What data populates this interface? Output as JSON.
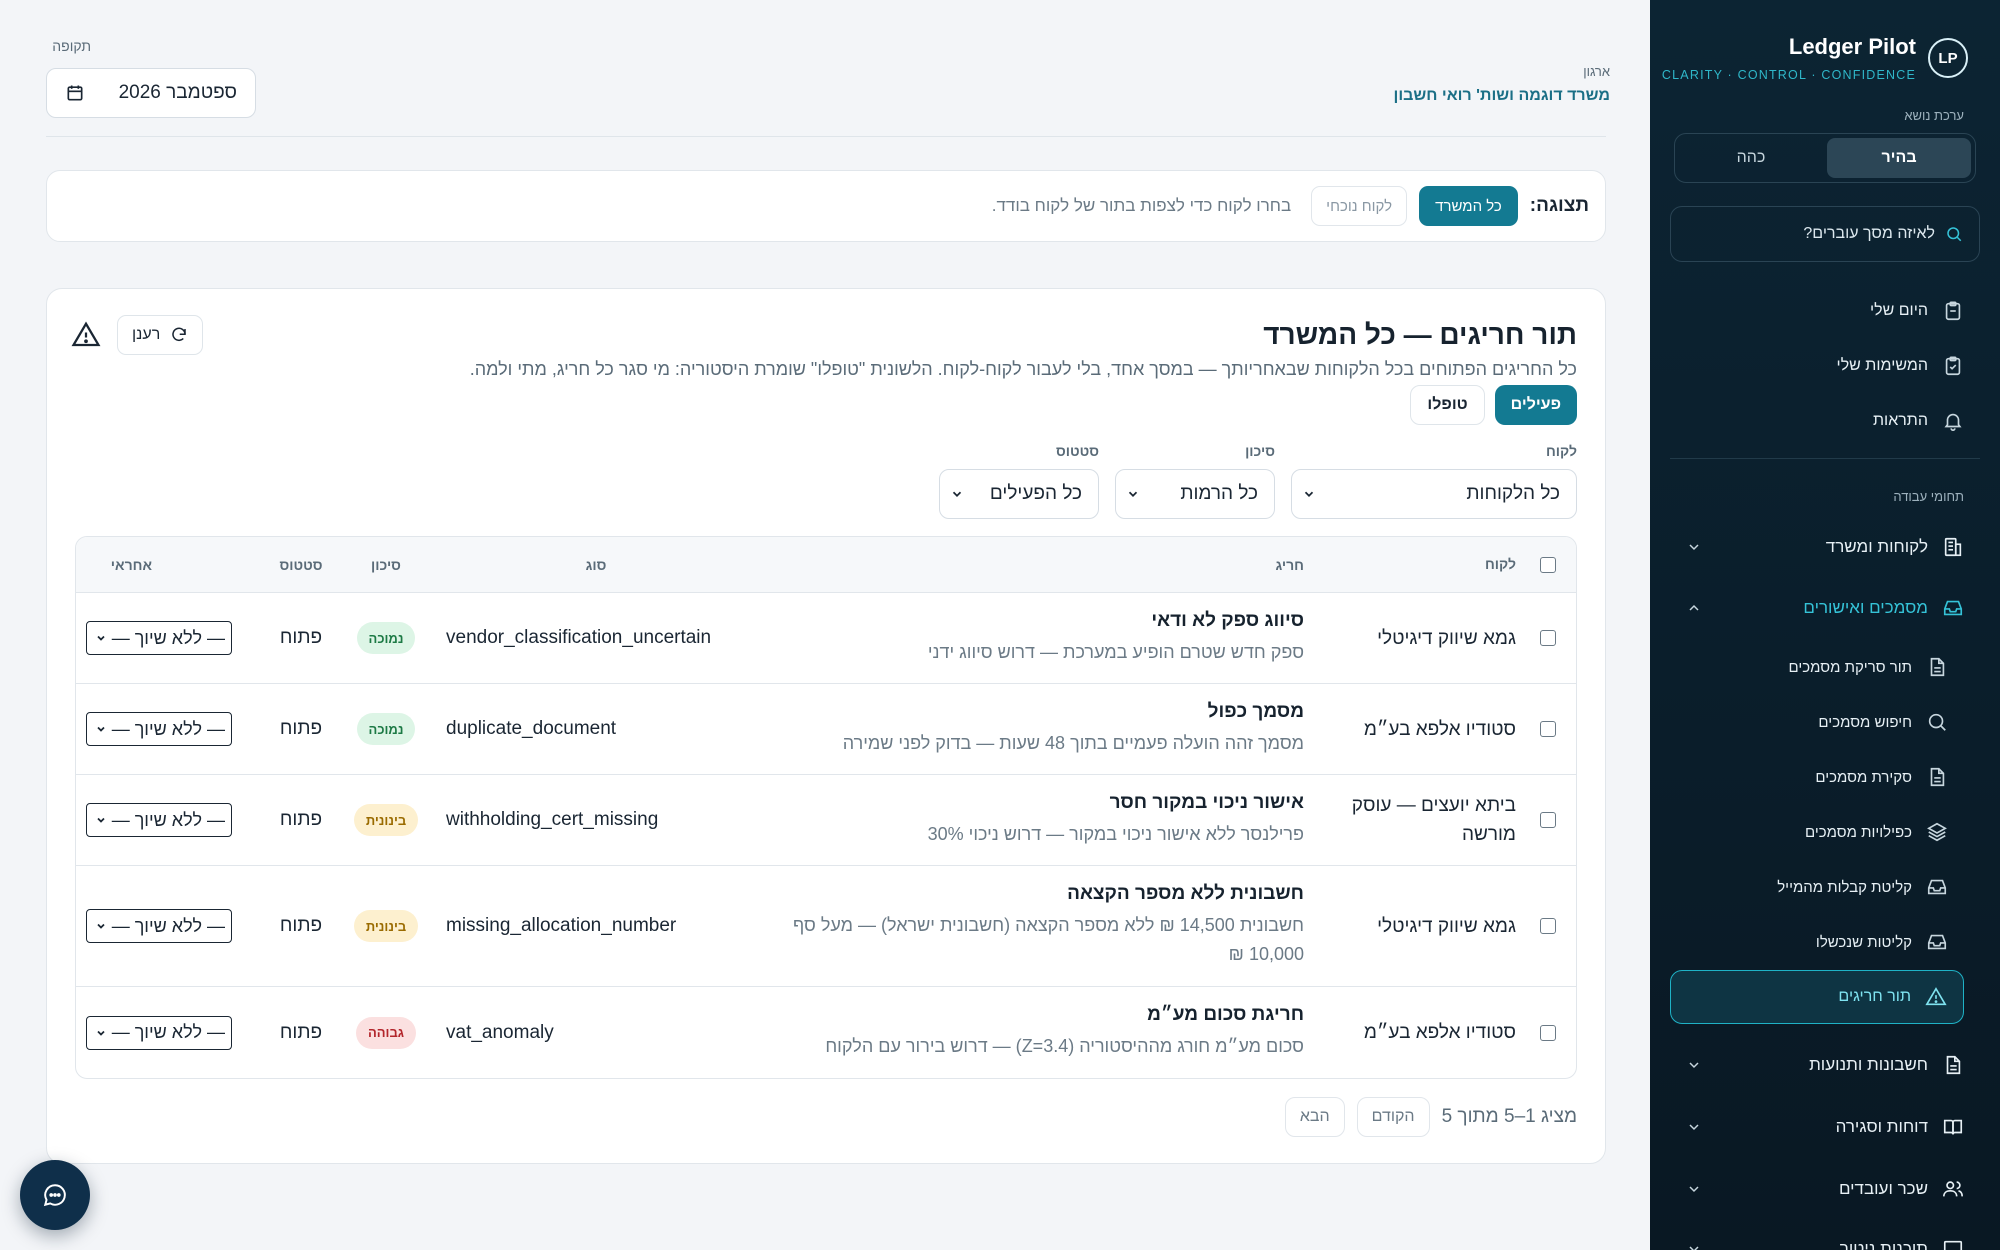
{
  "brand": {
    "name": "Ledger Pilot",
    "tagline": "CLARITY · CONTROL · CONFIDENCE",
    "logo_text": "LP"
  },
  "sidebar": {
    "theme_label": "ערכת נושא",
    "theme_light": "בהיר",
    "theme_dark": "כהה",
    "search_placeholder": "לאיזה מסך עוברים?",
    "personal": [
      {
        "label": "היום שלי",
        "icon": "clipboard-icon"
      },
      {
        "label": "המשימות שלי",
        "icon": "clipboard-check-icon"
      },
      {
        "label": "התראות",
        "icon": "bell-icon"
      }
    ],
    "work_areas_label": "תחומי עבודה",
    "groups": {
      "clients": "לקוחות ומשרד",
      "documents": "מסמכים ואישורים",
      "accounts": "חשבונות ותנועות",
      "reports": "דוחות וסגירה",
      "payroll": "שכר ועובדים",
      "cut": "תוכנות ניטור"
    },
    "doc_items": [
      {
        "label": "תור סריקת מסמכים",
        "icon": "document-icon"
      },
      {
        "label": "חיפוש מסמכים",
        "icon": "search-icon"
      },
      {
        "label": "סקירת מסמכים",
        "icon": "document-icon"
      },
      {
        "label": "כפילויות מסמכים",
        "icon": "layers-icon"
      },
      {
        "label": "קליטת קבלות מהמייל",
        "icon": "inbox-icon"
      },
      {
        "label": "קליטות שנכשלו",
        "icon": "inbox-icon"
      }
    ],
    "active_item": "תור חריגים"
  },
  "header": {
    "org_label": "ארגון",
    "org_name": "משרד דוגמה ושות' רואי חשבון",
    "period_label": "תקופה",
    "period_value": "ספטמבר 2026"
  },
  "view_bar": {
    "label": "תצוגה:",
    "all_office": "כל המשרד",
    "current_client": "לקוח נוכחי",
    "hint": "בחרו לקוח כדי לצפות בתור של לקוח בודד."
  },
  "queue": {
    "title": "תור חריגים — כל המשרד",
    "description": "כל החריגים הפתוחים בכל הלקוחות שבאחריותך — במסך אחד, בלי לעבור לקוח-לקוח. הלשונית \"טופלו\" שומרת היסטוריה: מי סגר כל חריג, מתי ולמה.",
    "refresh": "רענן",
    "tab_active": "פעילים",
    "tab_handled": "טופלו",
    "filters": {
      "client_label": "לקוח",
      "client_value": "כל הלקוחות",
      "risk_label": "סיכון",
      "risk_value": "כל הרמות",
      "status_label": "סטטוס",
      "status_value": "כל הפעילים"
    },
    "columns": {
      "client": "לקוח",
      "exception": "חריג",
      "type": "סוג",
      "risk": "סיכון",
      "status": "סטטוס",
      "owner": "אחראי"
    },
    "rows": [
      {
        "client": "גמא שיווק דיגיטלי",
        "title": "סיווג ספק לא ודאי",
        "desc": "ספק חדש שטרם הופיע במערכת — דרוש סיווג ידני",
        "type": "vendor_classification_uncertain",
        "risk": "נמוכה",
        "risk_level": "low",
        "status": "פתוח",
        "owner": "— ללא שיוך —"
      },
      {
        "client": "סטודיו אלפא בע״מ",
        "title": "מסמך כפול",
        "desc": "מסמך זהה הועלה פעמיים בתוך 48 שעות — בדוק לפני שמירה",
        "type": "duplicate_document",
        "risk": "נמוכה",
        "risk_level": "low",
        "status": "פתוח",
        "owner": "— ללא שיוך —"
      },
      {
        "client": "ביתא יועצים — עוסק מורשה",
        "title": "אישור ניכוי במקור חסר",
        "desc": "פרילנסר ללא אישור ניכוי במקור — דרוש ניכוי 30%",
        "type": "withholding_cert_missing",
        "risk": "בינונית",
        "risk_level": "mid",
        "status": "פתוח",
        "owner": "— ללא שיוך —"
      },
      {
        "client": "גמא שיווק דיגיטלי",
        "title": "חשבונית ללא מספר הקצאה",
        "desc": "חשבונית 14,500 ₪ ללא מספר הקצאה (חשבונית ישראל) — מעל סף 10,000 ₪",
        "type": "missing_allocation_number",
        "risk": "בינונית",
        "risk_level": "mid",
        "status": "פתוח",
        "owner": "— ללא שיוך —"
      },
      {
        "client": "סטודיו אלפא בע״מ",
        "title": "חריגת סכום מע״מ",
        "desc": "סכום מע״מ חורג מההיסטוריה (Z=3.4) — דרוש בירור עם הלקוח",
        "type": "vat_anomaly",
        "risk": "גבוהה",
        "risk_level": "high",
        "status": "פתוח",
        "owner": "— ללא שיוך —"
      }
    ],
    "pager_text": "מציג 1–5 מתוך 5",
    "prev": "הקודם",
    "next": "הבא"
  },
  "colors": {
    "accent": "#137a92",
    "sidebar_bg": "#0c2433",
    "active_nav": "#35c3d8"
  }
}
